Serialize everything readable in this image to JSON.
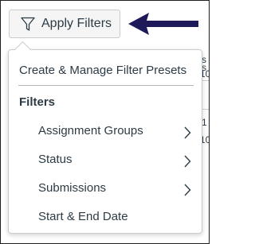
{
  "toolbar": {
    "apply_filters_label": "Apply Filters",
    "filter_icon": "filter-funnel-icon",
    "callout_arrow_icon": "left-arrow-icon",
    "arrow_color": "#1e1a5a"
  },
  "background": {
    "fragments": [
      "s",
      "s",
      "10",
      "1",
      "10"
    ]
  },
  "filters_menu": {
    "presets_label": "Create & Manage Filter Presets",
    "section_title": "Filters",
    "items": [
      {
        "label": "Assignment Groups",
        "has_submenu": true,
        "icon": "chevron-right-icon"
      },
      {
        "label": "Status",
        "has_submenu": true,
        "icon": "chevron-right-icon"
      },
      {
        "label": "Submissions",
        "has_submenu": true,
        "icon": "chevron-right-icon"
      },
      {
        "label": "Start & End Date",
        "has_submenu": false
      }
    ]
  }
}
